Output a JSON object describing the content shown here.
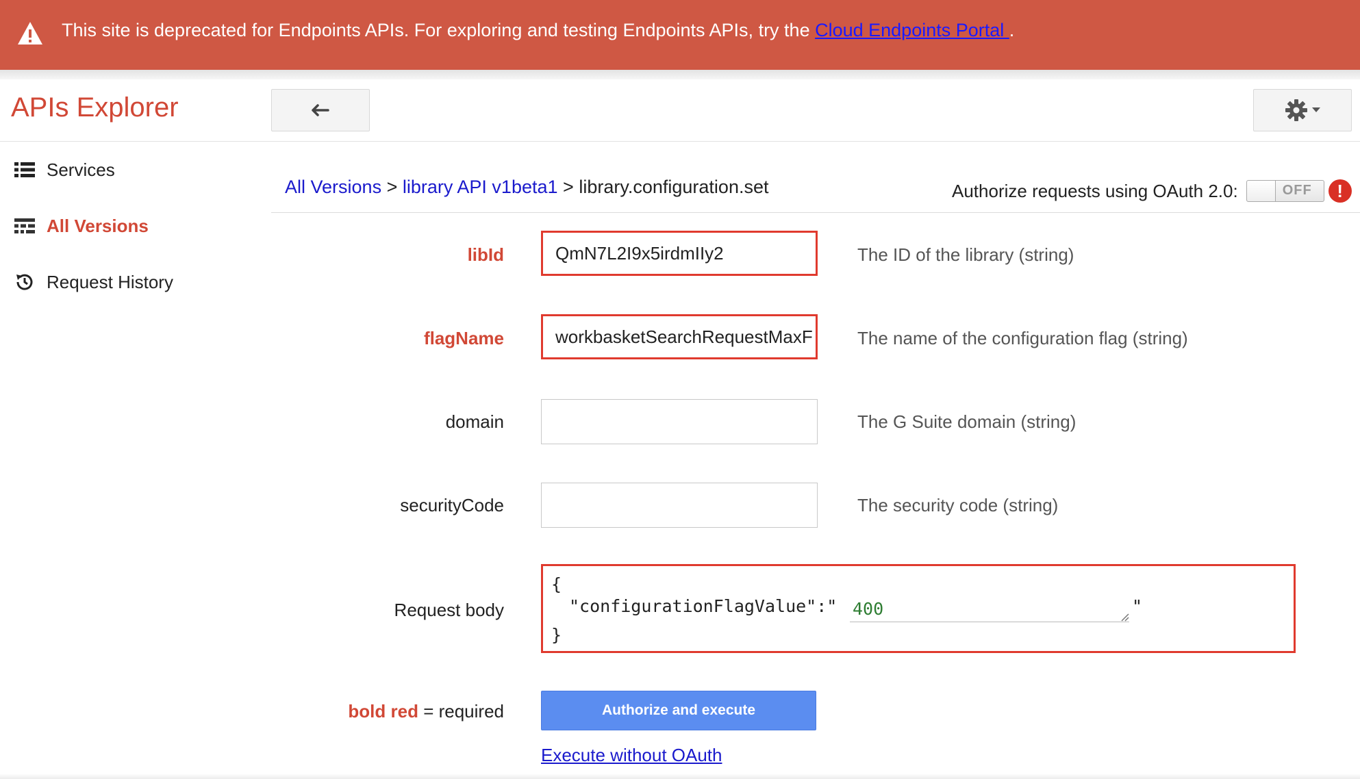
{
  "banner": {
    "message": "This site is deprecated for Endpoints APIs. For exploring and testing Endpoints APIs, try the ",
    "link_text": "Cloud Endpoints Portal ",
    "suffix": "."
  },
  "header": {
    "app_title": "APIs Explorer"
  },
  "sidebar": {
    "items": [
      {
        "label": "Services",
        "icon": "list-icon",
        "active": false
      },
      {
        "label": "All Versions",
        "icon": "versions-icon",
        "active": true
      },
      {
        "label": "Request History",
        "icon": "history-icon",
        "active": false
      }
    ]
  },
  "breadcrumb": {
    "items": [
      "All Versions",
      "library API v1beta1",
      "library.configuration.set"
    ],
    "separator": ">"
  },
  "oauth": {
    "label": "Authorize requests using OAuth 2.0:",
    "toggle_state": "OFF",
    "alert_symbol": "!"
  },
  "form": {
    "fields": [
      {
        "label": "libId",
        "required": true,
        "value": "QmN7L2I9x5irdmIIy2",
        "description": "The ID of the library (string)"
      },
      {
        "label": "flagName",
        "required": true,
        "value": "workbasketSearchRequestMaxF",
        "description": "The name of the configuration flag (string)"
      },
      {
        "label": "domain",
        "required": false,
        "value": "",
        "description": "The G Suite domain (string)"
      },
      {
        "label": "securityCode",
        "required": false,
        "value": "",
        "description": "The security code (string)"
      }
    ],
    "request_body": {
      "label": "Request body",
      "open_brace": "{",
      "key": "\"configurationFlagValue\":\"",
      "value": "400",
      "close_quote": "\"",
      "close_brace": "}"
    }
  },
  "legend": {
    "bold_red": "bold red",
    "rest": " = required"
  },
  "actions": {
    "execute_label": "Authorize and execute",
    "execute_without_oauth": "Execute without OAuth"
  },
  "colors": {
    "banner": "#cf5844",
    "accent": "#d14836",
    "link": "#1a1acc",
    "button": "#5b8df0",
    "highlight": "#e03a2e"
  }
}
